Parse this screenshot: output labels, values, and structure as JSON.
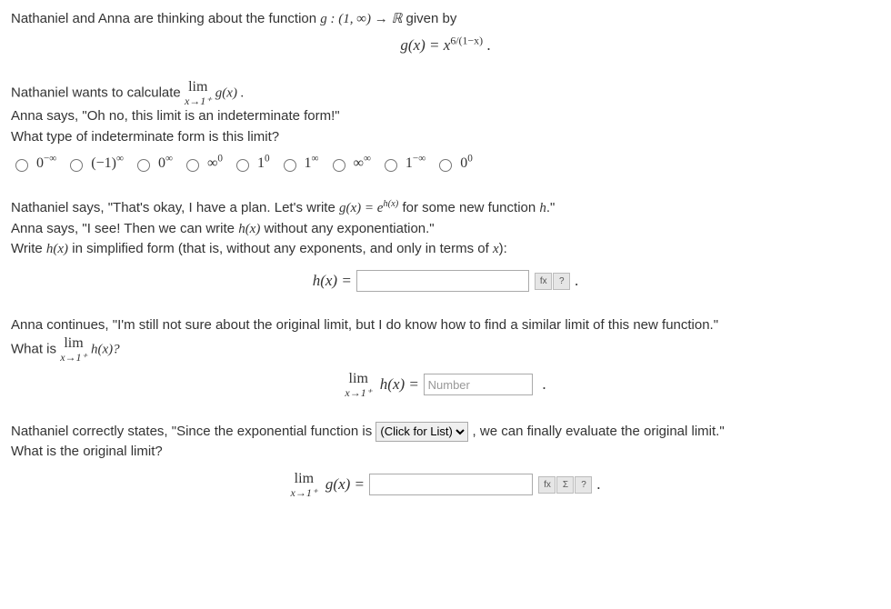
{
  "intro": {
    "line1_a": "Nathaniel and Anna are thinking about the function ",
    "g_decl": "g : (1, ∞) → ℝ",
    "line1_b": " given by",
    "g_def_lhs": "g(x) = ",
    "g_def_base": "x",
    "g_def_exp": "6/(1−x)",
    "period": " ."
  },
  "part1": {
    "line_a": "Nathaniel wants to calculate ",
    "lim_top": "lim",
    "lim_bot": "x→1⁺",
    "gx": " g(x) .",
    "anna": "Anna says, \"Oh no, this limit is an indeterminate form!\"",
    "question": "What type of indeterminate form is this limit?"
  },
  "options": [
    {
      "base": "0",
      "exp": "−∞"
    },
    {
      "base": "(−1)",
      "exp": "∞"
    },
    {
      "base": "0",
      "exp": "∞"
    },
    {
      "base": "∞",
      "exp": "0"
    },
    {
      "base": "1",
      "exp": "0"
    },
    {
      "base": "1",
      "exp": "∞"
    },
    {
      "base": "∞",
      "exp": "∞"
    },
    {
      "base": "1",
      "exp": "−∞"
    },
    {
      "base": "0",
      "exp": "0"
    }
  ],
  "part2": {
    "nathaniel_a": "Nathaniel says, \"That's okay, I have a plan. Let's write ",
    "geq": "g(x) = e",
    "g_exp": "h(x)",
    "nathaniel_b": " for some new function ",
    "h": "h",
    "nathaniel_c": ".\"",
    "anna": "Anna says, \"I see! Then we can write ",
    "hx": "h(x)",
    "anna_b": " without any exponentiation.\"",
    "write_a": "Write ",
    "write_b": " in simplified form (that is, without any exponents, and only in terms of ",
    "x": "x",
    "write_c": "):",
    "hx_eq": "h(x) ="
  },
  "part3": {
    "anna": "Anna continues, \"I'm still not sure about the original limit, but I do know how to find a similar limit of this new function.\"",
    "q_a": "What is ",
    "lim_top": "lim",
    "lim_bot": "x→1⁺",
    "hx": " h(x)?",
    "eq_lhs": "h(x) =",
    "placeholder": "Number"
  },
  "part4": {
    "nathaniel_a": "Nathaniel correctly states, \"Since the exponential function is ",
    "dropdown": "(Click for List)",
    "nathaniel_b": " , we can finally evaluate the original limit.\"",
    "question": "What is the original limit?",
    "lim_top": "lim",
    "lim_bot": "x→1⁺",
    "gx_eq": " g(x) ="
  },
  "dot": "."
}
